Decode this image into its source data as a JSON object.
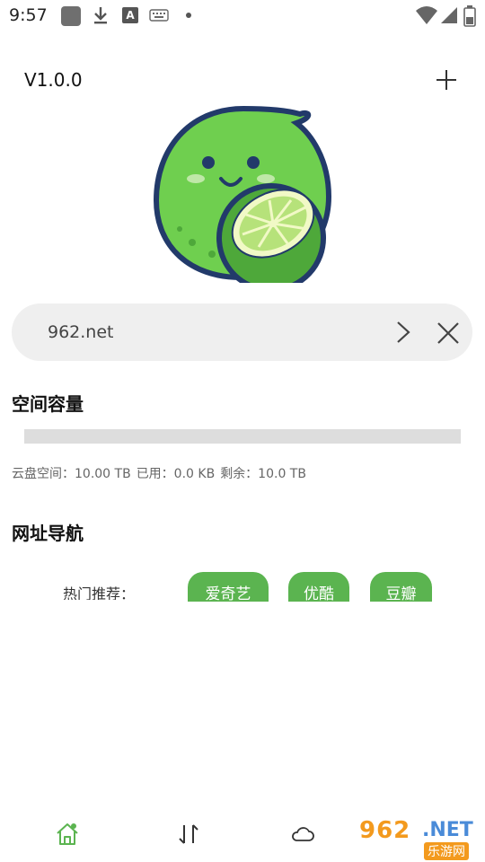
{
  "status_bar": {
    "time": "9:57",
    "icons": [
      "photo-icon",
      "download-icon",
      "font-icon",
      "keyboard-icon",
      "dot-icon",
      "wifi-icon",
      "signal-icon",
      "battery-icon"
    ],
    "a_glyph": "A"
  },
  "header": {
    "version": "V1.0.0",
    "add_icon": "plus-icon"
  },
  "search": {
    "value": "962.net",
    "go_icon": "chevron-right-icon",
    "clear_icon": "close-icon"
  },
  "capacity": {
    "title": "空间容量",
    "used_fraction": 0.0,
    "cloud_label": "云盘空间：10.00 TB",
    "used_label": "已用：0.0 KB",
    "remaining_label": "剩余：10.0 TB"
  },
  "nav": {
    "title": "网址导航",
    "recommend_label": "热门推荐：",
    "sites": [
      "爱奇艺",
      "优酷",
      "豆瓣"
    ]
  },
  "bottom_nav": {
    "items": [
      "home-icon",
      "transfer-icon",
      "cloud-icon"
    ]
  },
  "watermark": {
    "number": "962",
    "domain": ".NET",
    "site_name": "乐游网"
  },
  "colors": {
    "accent": "#5bb450",
    "search_bg": "#efefef",
    "progress_track": "#dddddd",
    "lime_body": "#6fcf4f",
    "lime_outline": "#223a6a"
  }
}
